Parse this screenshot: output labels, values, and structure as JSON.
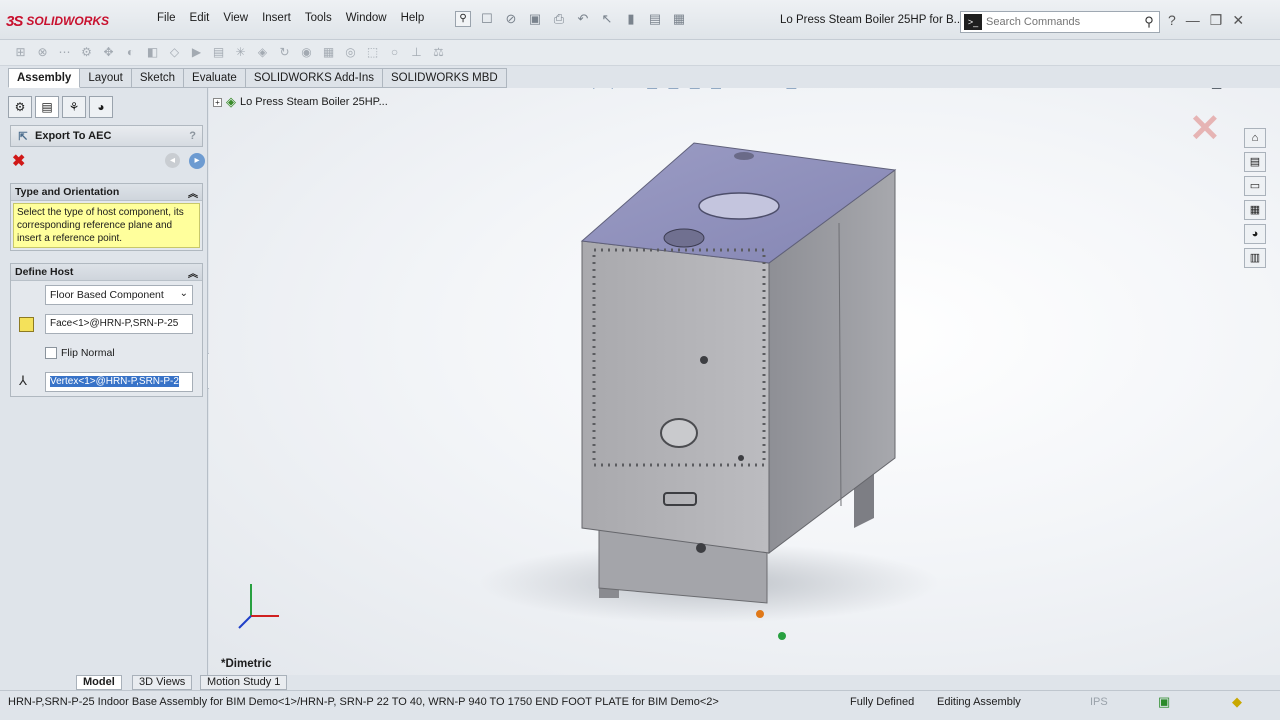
{
  "app": {
    "brand": "SOLIDWORKS",
    "doc_title": "Lo Press Steam Boiler 25HP for B..."
  },
  "menu": [
    "File",
    "Edit",
    "View",
    "Insert",
    "Tools",
    "Window",
    "Help"
  ],
  "search": {
    "placeholder": "Search Commands"
  },
  "tabs": [
    "Assembly",
    "Layout",
    "Sketch",
    "Evaluate",
    "SOLIDWORKS Add-Ins",
    "SOLIDWORKS MBD"
  ],
  "panel": {
    "title": "Export To AEC",
    "help": "?",
    "type_group": {
      "title": "Type and Orientation",
      "message": "Select the type of host component, its corresponding reference plane and insert a reference point."
    },
    "host_group": {
      "title": "Define Host",
      "component_type": "Floor Based Component",
      "face": "Face<1>@HRN-P,SRN-P-25",
      "flip_normal": "Flip Normal",
      "vertex": "Vertex<1>@HRN-P,SRN-P-2"
    }
  },
  "viewport": {
    "tree_node": "Lo Press Steam Boiler 25HP...",
    "view_orientation": "*Dimetric"
  },
  "bottom_tabs": [
    "Model",
    "3D Views",
    "Motion Study 1"
  ],
  "status": {
    "path": "HRN-P,SRN-P-25 Indoor Base Assembly for BIM Demo<1>/HRN-P, SRN-P 22 TO 40, WRN-P 940 TO 1750 END FOOT PLATE for BIM Demo<2>",
    "defined": "Fully Defined",
    "mode": "Editing Assembly",
    "units": "IPS"
  },
  "colors": {
    "brand": "#c8102e",
    "selection": "#3873c8",
    "message_bg": "#ffff9c"
  }
}
